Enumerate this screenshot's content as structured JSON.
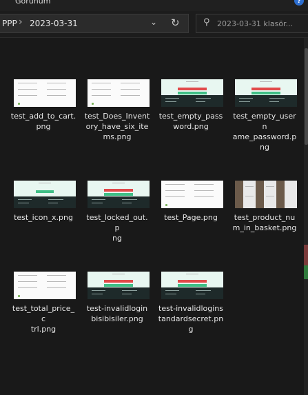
{
  "window": {
    "menu_label": "Görünüm",
    "help_glyph": "?"
  },
  "address_bar": {
    "parent_segment": "PPP",
    "separator": "›",
    "current_folder": "2023-03-31",
    "dropdown_glyph": "⌄",
    "refresh_glyph": "↻"
  },
  "search": {
    "placeholder": "2023-03-31 klasör..."
  },
  "files": [
    {
      "name": "test_add_to_cart.png",
      "lines": [
        "test_add_to_cart.",
        "png"
      ],
      "thumb_style": "white"
    },
    {
      "name": "test_Does_Inventory_have_six_items.png",
      "lines": [
        "test_Does_Invent",
        "ory_have_six_ite",
        "ms.png"
      ],
      "thumb_style": "white"
    },
    {
      "name": "test_empty_password.png",
      "lines": [
        "test_empty_pass",
        "word.png"
      ],
      "thumb_style": "mint-error"
    },
    {
      "name": "test_empty_username_password.png",
      "lines": [
        "test_empty_usern",
        "ame_password.p",
        "ng"
      ],
      "thumb_style": "mint-error"
    },
    {
      "name": "test_icon_x.png",
      "lines": [
        "test_icon_x.png"
      ],
      "thumb_style": "mint-ok"
    },
    {
      "name": "test_locked_out.png",
      "lines": [
        "test_locked_out.p",
        "ng"
      ],
      "thumb_style": "mint-error"
    },
    {
      "name": "test_Page.png",
      "lines": [
        "test_Page.png"
      ],
      "thumb_style": "white"
    },
    {
      "name": "test_product_num_in_basket.png",
      "lines": [
        "test_product_nu",
        "m_in_basket.png"
      ],
      "thumb_style": "photo"
    },
    {
      "name": "test_total_price_ctrl.png",
      "lines": [
        "test_total_price_c",
        "trl.png"
      ],
      "thumb_style": "white"
    },
    {
      "name": "test-invalidloginbisibisiler.png",
      "lines": [
        "test-invalidlogin",
        "bisibisiler.png"
      ],
      "thumb_style": "mint-error"
    },
    {
      "name": "test-invalidloginstandardsecret.png",
      "lines": [
        "test-invalidlogins",
        "tandardsecret.pn",
        "g"
      ],
      "thumb_style": "mint-error"
    }
  ],
  "colors": {
    "background": "#191919",
    "error_red": "#e14a4a",
    "ok_green": "#3fbf86",
    "help_blue": "#2d6fd1"
  },
  "icons": {
    "search": "search-icon",
    "refresh": "refresh-icon",
    "dropdown": "chevron-down-icon",
    "help": "help-icon"
  }
}
